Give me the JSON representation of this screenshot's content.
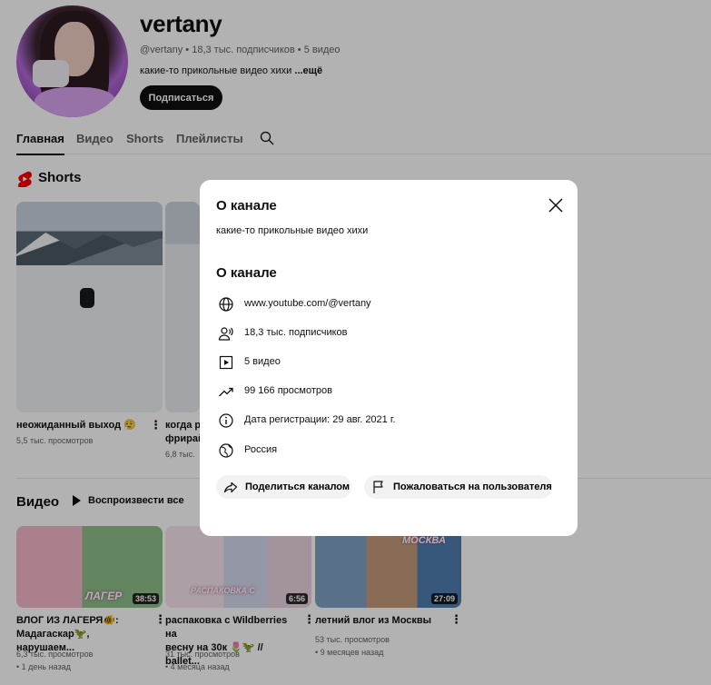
{
  "channel": {
    "name": "vertany",
    "meta": "@vertany • 18,3 тыс. подписчиков • 5 видео",
    "description": "какие-то прикольные видео хихи",
    "more_label": "...ещё",
    "subscribe_label": "Подписаться"
  },
  "tabs": [
    {
      "label": "Главная",
      "active": true
    },
    {
      "label": "Видео",
      "active": false
    },
    {
      "label": "Shorts",
      "active": false
    },
    {
      "label": "Плейлисты",
      "active": false
    }
  ],
  "shorts_section": {
    "title": "Shorts",
    "items": [
      {
        "title": "неожиданный выход 😮‍💨",
        "views": "5,5 тыс. просмотров"
      },
      {
        "title": "когда р… фрирай…",
        "title_line1": "когда р",
        "title_line2": "фрирай",
        "views": "6,8 тыс."
      }
    ]
  },
  "videos_section": {
    "title": "Видео",
    "play_all_label": "Воспроизвести все",
    "items": [
      {
        "title": "ВЛОГ ИЗ ЛАГЕРЯ🐠: Мадагаскар🦖, нарушаем…",
        "title_line1": "ВЛОГ ИЗ ЛАГЕРЯ🐠:",
        "title_line2": "Мадагаскар🦖, нарушаем...",
        "duration": "38:53",
        "views": "6,3 тыс. просмотров",
        "age": "1 день назад",
        "thumb_text": "ЛАГЕР"
      },
      {
        "title": "распаковка с Wildberries на весну на 30к",
        "title_line1": "распаковка с Wildberries на",
        "title_line2": "весну на 30к 🌷🦖 // ballet...",
        "duration": "6:56",
        "views": "31 тыс. просмотров",
        "age": "4 месяца назад",
        "thumb_text": "РАСПАКОВКА С"
      },
      {
        "title": "летний влог из Москвы",
        "title_line1": "летний влог из Москвы",
        "title_line2": "",
        "duration": "27:09",
        "views": "53 тыс. просмотров",
        "age": "9 месяцев назад",
        "thumb_text": "МОСКВА"
      }
    ]
  },
  "modal": {
    "title1": "О канале",
    "description": "какие-то прикольные видео хихи",
    "title2": "О канале",
    "rows": [
      {
        "icon": "globe-icon",
        "text": "www.youtube.com/@vertany"
      },
      {
        "icon": "subscribers-icon",
        "text": "18,3 тыс. подписчиков"
      },
      {
        "icon": "video-icon",
        "text": "5 видео"
      },
      {
        "icon": "trending-icon",
        "text": "99 166 просмотров"
      },
      {
        "icon": "info-icon",
        "text": "Дата регистрации: 29 авг. 2021 г."
      },
      {
        "icon": "globe-location-icon",
        "text": "Россия"
      }
    ],
    "share_label": "Поделиться каналом",
    "report_label": "Пожаловаться на пользователя"
  }
}
